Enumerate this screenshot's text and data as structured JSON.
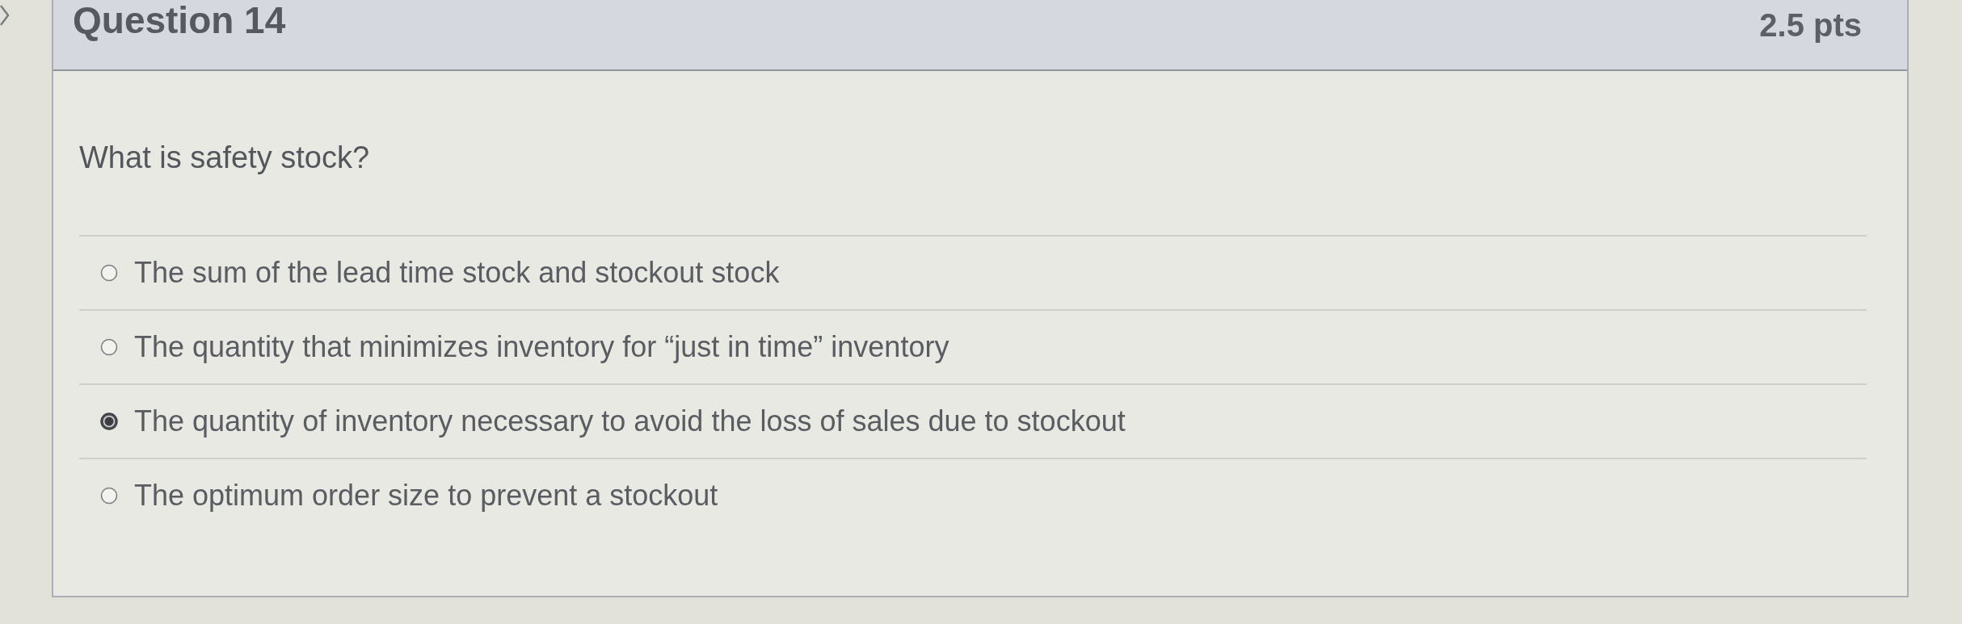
{
  "question": {
    "title": "Question 14",
    "points": "2.5 pts",
    "prompt": "What is safety stock?",
    "options": [
      {
        "label": "The sum of the lead time stock and stockout stock",
        "selected": false
      },
      {
        "label": "The quantity that minimizes inventory for “just in time” inventory",
        "selected": false
      },
      {
        "label": "The quantity of inventory necessary to avoid the loss of sales due to stockout",
        "selected": true
      },
      {
        "label": "The optimum order size to prevent a stockout",
        "selected": false
      }
    ]
  }
}
